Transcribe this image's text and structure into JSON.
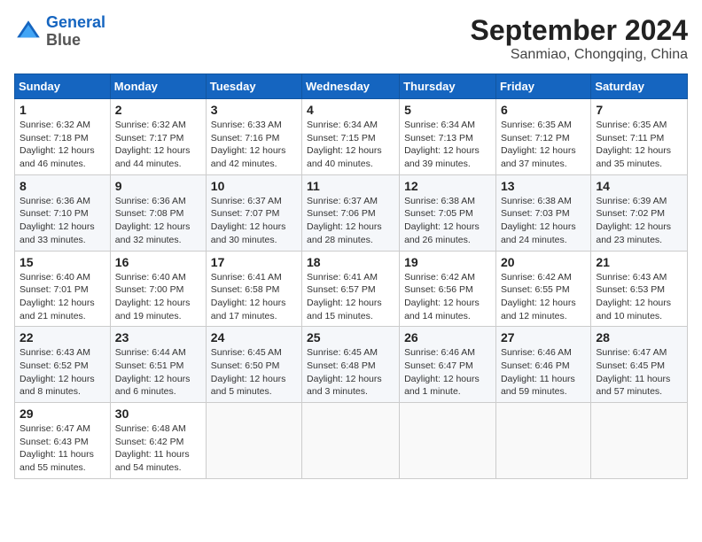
{
  "header": {
    "logo_line1": "General",
    "logo_line2": "Blue",
    "title": "September 2024",
    "location": "Sanmiao, Chongqing, China"
  },
  "weekdays": [
    "Sunday",
    "Monday",
    "Tuesday",
    "Wednesday",
    "Thursday",
    "Friday",
    "Saturday"
  ],
  "weeks": [
    [
      {
        "day": "1",
        "sunrise": "6:32 AM",
        "sunset": "7:18 PM",
        "daylight": "12 hours and 46 minutes."
      },
      {
        "day": "2",
        "sunrise": "6:32 AM",
        "sunset": "7:17 PM",
        "daylight": "12 hours and 44 minutes."
      },
      {
        "day": "3",
        "sunrise": "6:33 AM",
        "sunset": "7:16 PM",
        "daylight": "12 hours and 42 minutes."
      },
      {
        "day": "4",
        "sunrise": "6:34 AM",
        "sunset": "7:15 PM",
        "daylight": "12 hours and 40 minutes."
      },
      {
        "day": "5",
        "sunrise": "6:34 AM",
        "sunset": "7:13 PM",
        "daylight": "12 hours and 39 minutes."
      },
      {
        "day": "6",
        "sunrise": "6:35 AM",
        "sunset": "7:12 PM",
        "daylight": "12 hours and 37 minutes."
      },
      {
        "day": "7",
        "sunrise": "6:35 AM",
        "sunset": "7:11 PM",
        "daylight": "12 hours and 35 minutes."
      }
    ],
    [
      {
        "day": "8",
        "sunrise": "6:36 AM",
        "sunset": "7:10 PM",
        "daylight": "12 hours and 33 minutes."
      },
      {
        "day": "9",
        "sunrise": "6:36 AM",
        "sunset": "7:08 PM",
        "daylight": "12 hours and 32 minutes."
      },
      {
        "day": "10",
        "sunrise": "6:37 AM",
        "sunset": "7:07 PM",
        "daylight": "12 hours and 30 minutes."
      },
      {
        "day": "11",
        "sunrise": "6:37 AM",
        "sunset": "7:06 PM",
        "daylight": "12 hours and 28 minutes."
      },
      {
        "day": "12",
        "sunrise": "6:38 AM",
        "sunset": "7:05 PM",
        "daylight": "12 hours and 26 minutes."
      },
      {
        "day": "13",
        "sunrise": "6:38 AM",
        "sunset": "7:03 PM",
        "daylight": "12 hours and 24 minutes."
      },
      {
        "day": "14",
        "sunrise": "6:39 AM",
        "sunset": "7:02 PM",
        "daylight": "12 hours and 23 minutes."
      }
    ],
    [
      {
        "day": "15",
        "sunrise": "6:40 AM",
        "sunset": "7:01 PM",
        "daylight": "12 hours and 21 minutes."
      },
      {
        "day": "16",
        "sunrise": "6:40 AM",
        "sunset": "7:00 PM",
        "daylight": "12 hours and 19 minutes."
      },
      {
        "day": "17",
        "sunrise": "6:41 AM",
        "sunset": "6:58 PM",
        "daylight": "12 hours and 17 minutes."
      },
      {
        "day": "18",
        "sunrise": "6:41 AM",
        "sunset": "6:57 PM",
        "daylight": "12 hours and 15 minutes."
      },
      {
        "day": "19",
        "sunrise": "6:42 AM",
        "sunset": "6:56 PM",
        "daylight": "12 hours and 14 minutes."
      },
      {
        "day": "20",
        "sunrise": "6:42 AM",
        "sunset": "6:55 PM",
        "daylight": "12 hours and 12 minutes."
      },
      {
        "day": "21",
        "sunrise": "6:43 AM",
        "sunset": "6:53 PM",
        "daylight": "12 hours and 10 minutes."
      }
    ],
    [
      {
        "day": "22",
        "sunrise": "6:43 AM",
        "sunset": "6:52 PM",
        "daylight": "12 hours and 8 minutes."
      },
      {
        "day": "23",
        "sunrise": "6:44 AM",
        "sunset": "6:51 PM",
        "daylight": "12 hours and 6 minutes."
      },
      {
        "day": "24",
        "sunrise": "6:45 AM",
        "sunset": "6:50 PM",
        "daylight": "12 hours and 5 minutes."
      },
      {
        "day": "25",
        "sunrise": "6:45 AM",
        "sunset": "6:48 PM",
        "daylight": "12 hours and 3 minutes."
      },
      {
        "day": "26",
        "sunrise": "6:46 AM",
        "sunset": "6:47 PM",
        "daylight": "12 hours and 1 minute."
      },
      {
        "day": "27",
        "sunrise": "6:46 AM",
        "sunset": "6:46 PM",
        "daylight": "11 hours and 59 minutes."
      },
      {
        "day": "28",
        "sunrise": "6:47 AM",
        "sunset": "6:45 PM",
        "daylight": "11 hours and 57 minutes."
      }
    ],
    [
      {
        "day": "29",
        "sunrise": "6:47 AM",
        "sunset": "6:43 PM",
        "daylight": "11 hours and 55 minutes."
      },
      {
        "day": "30",
        "sunrise": "6:48 AM",
        "sunset": "6:42 PM",
        "daylight": "11 hours and 54 minutes."
      },
      null,
      null,
      null,
      null,
      null
    ]
  ],
  "labels": {
    "sunrise": "Sunrise:",
    "sunset": "Sunset:",
    "daylight": "Daylight: "
  }
}
